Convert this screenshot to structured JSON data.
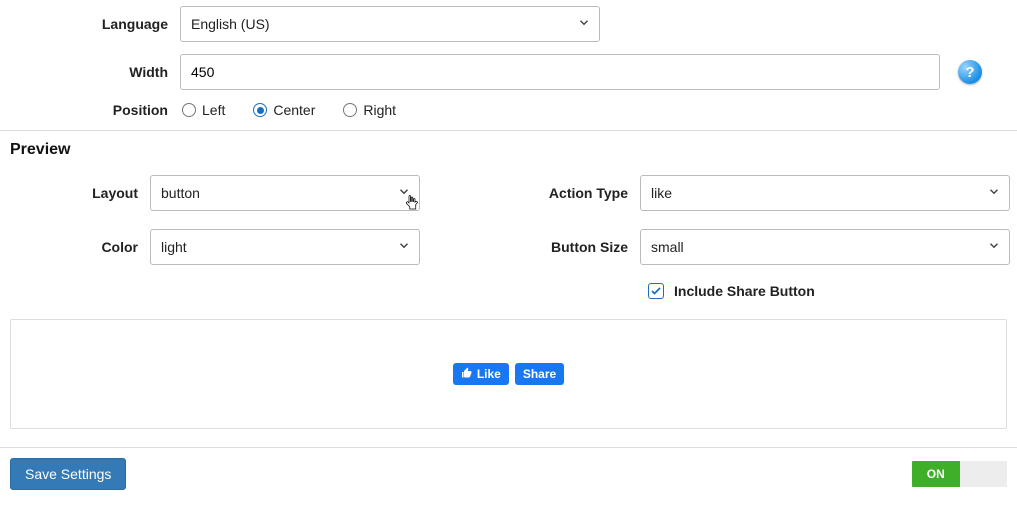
{
  "labels": {
    "language": "Language",
    "width": "Width",
    "position": "Position",
    "preview": "Preview",
    "layout": "Layout",
    "actionType": "Action Type",
    "color": "Color",
    "buttonSize": "Button Size",
    "includeShare": "Include Share Button",
    "save": "Save Settings"
  },
  "values": {
    "language": "English (US)",
    "width": "450",
    "position": "Center",
    "layout": "button",
    "actionType": "like",
    "color": "light",
    "buttonSize": "small",
    "includeShare": true,
    "toggle": "ON"
  },
  "options": {
    "position": [
      "Left",
      "Center",
      "Right"
    ]
  },
  "preview": {
    "likeLabel": "Like",
    "shareLabel": "Share"
  },
  "help": "?"
}
